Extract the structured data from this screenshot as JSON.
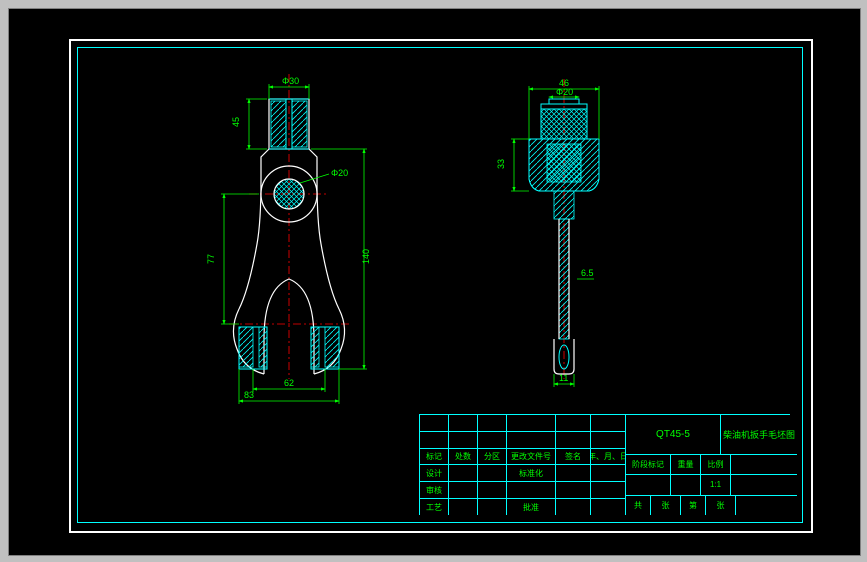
{
  "dimensions": {
    "left_view": {
      "top_width": "Φ30",
      "left_height_upper": "45",
      "left_height_lower": "77",
      "circle_diameter": "Φ20",
      "bottom_inner": "62",
      "bottom_outer": "83",
      "right_height": "140"
    },
    "right_view": {
      "top_width": "46",
      "top_inner": "Φ20",
      "left_height": "33",
      "slot_width": "6.5",
      "bottom_width": "11"
    }
  },
  "titleblock": {
    "material_code": "QT45-5",
    "drawing_title": "柴油机扳手毛坯图",
    "headers": {
      "h1": "标记",
      "h2": "处数",
      "h3": "分区",
      "h4": "更改文件号",
      "h5": "签名",
      "h6": "年、月、日"
    },
    "rows": {
      "r1": "设计",
      "r2": "审核",
      "r3": "工艺",
      "c1": "标准化",
      "c2": "批准"
    },
    "right_labels": {
      "l1": "阶段标记",
      "l2": "重量",
      "l3": "比例",
      "scale": "1:1",
      "sheet": "共",
      "sheet2": "张",
      "sheet3": "第",
      "sheet4": "张"
    }
  }
}
